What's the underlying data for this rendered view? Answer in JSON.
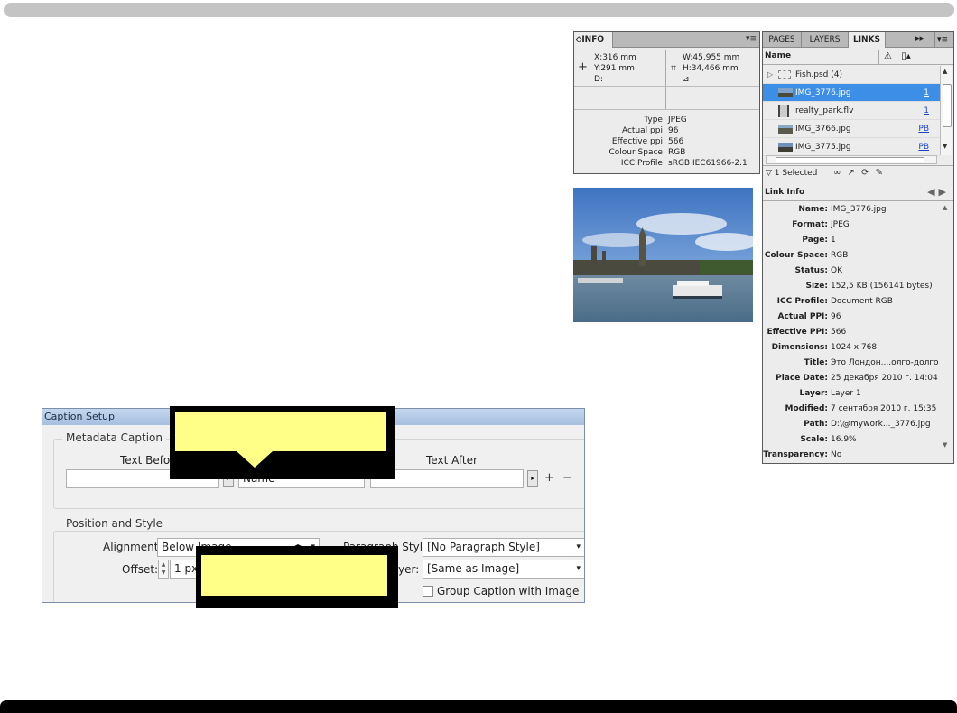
{
  "info_panel": {
    "tab": "INFO",
    "menu_icon": "panel-menu-icon",
    "x": "X:316 mm",
    "y": "Y:291 mm",
    "d": "D:",
    "w": "W:45,955 mm",
    "h": "H:34,466 mm",
    "details": [
      {
        "k": "Type:",
        "v": "JPEG"
      },
      {
        "k": "Actual ppi:",
        "v": "96"
      },
      {
        "k": "Effective ppi:",
        "v": "566"
      },
      {
        "k": "Colour Space:",
        "v": "RGB"
      },
      {
        "k": "ICC Profile:",
        "v": "sRGB IEC61966-2.1"
      }
    ]
  },
  "links_panel": {
    "tabs": {
      "pages": "PAGES",
      "layers": "LAYERS",
      "links": "LINKS"
    },
    "col_name": "Name",
    "rows": [
      {
        "name": "Fish.psd (4)",
        "page": ""
      },
      {
        "name": "IMG_3776.jpg",
        "page": "1"
      },
      {
        "name": "realty_park.flv",
        "page": "1"
      },
      {
        "name": "IMG_3766.jpg",
        "page": "PB"
      },
      {
        "name": "IMG_3775.jpg",
        "page": "PB"
      }
    ],
    "status": "1 Selected",
    "link_info_title": "Link Info",
    "link_info": [
      {
        "k": "Name:",
        "v": "IMG_3776.jpg"
      },
      {
        "k": "Format:",
        "v": "JPEG"
      },
      {
        "k": "Page:",
        "v": "1"
      },
      {
        "k": "Colour Space:",
        "v": "RGB"
      },
      {
        "k": "Status:",
        "v": "OK"
      },
      {
        "k": "Size:",
        "v": "152,5 KB (156141 bytes)"
      },
      {
        "k": "ICC Profile:",
        "v": "Document RGB"
      },
      {
        "k": "Actual PPI:",
        "v": "96"
      },
      {
        "k": "Effective PPI:",
        "v": "566"
      },
      {
        "k": "Dimensions:",
        "v": "1024 x 768"
      },
      {
        "k": "Title:",
        "v": "Это Лондон....олго-долго"
      },
      {
        "k": "Place Date:",
        "v": "25 декабря 2010 г. 14:04"
      },
      {
        "k": "Layer:",
        "v": "Layer 1"
      },
      {
        "k": "Modified:",
        "v": "7 сентября 2010 г. 15:35"
      },
      {
        "k": "Path:",
        "v": "D:\\@mywork..._3776.jpg"
      },
      {
        "k": "Scale:",
        "v": "16.9%"
      },
      {
        "k": "Transparency:",
        "v": "No"
      }
    ]
  },
  "caption_setup": {
    "title": "Caption Setup",
    "metadata_group": "Metadata Caption",
    "text_before_label": "Text Before",
    "text_after_label": "Text After",
    "metadata_value": "Name",
    "position_group": "Position and Style",
    "alignment_label": "Alignment:",
    "alignment_value": "Below Image",
    "offset_label": "Offset:",
    "offset_value": "1 px",
    "paragraph_style_label": "Paragraph Style:",
    "paragraph_style_value": "[No Paragraph Style]",
    "layer_label": "Layer:",
    "layer_value": "[Same as Image]",
    "group_caption_label": "Group Caption with Image"
  }
}
